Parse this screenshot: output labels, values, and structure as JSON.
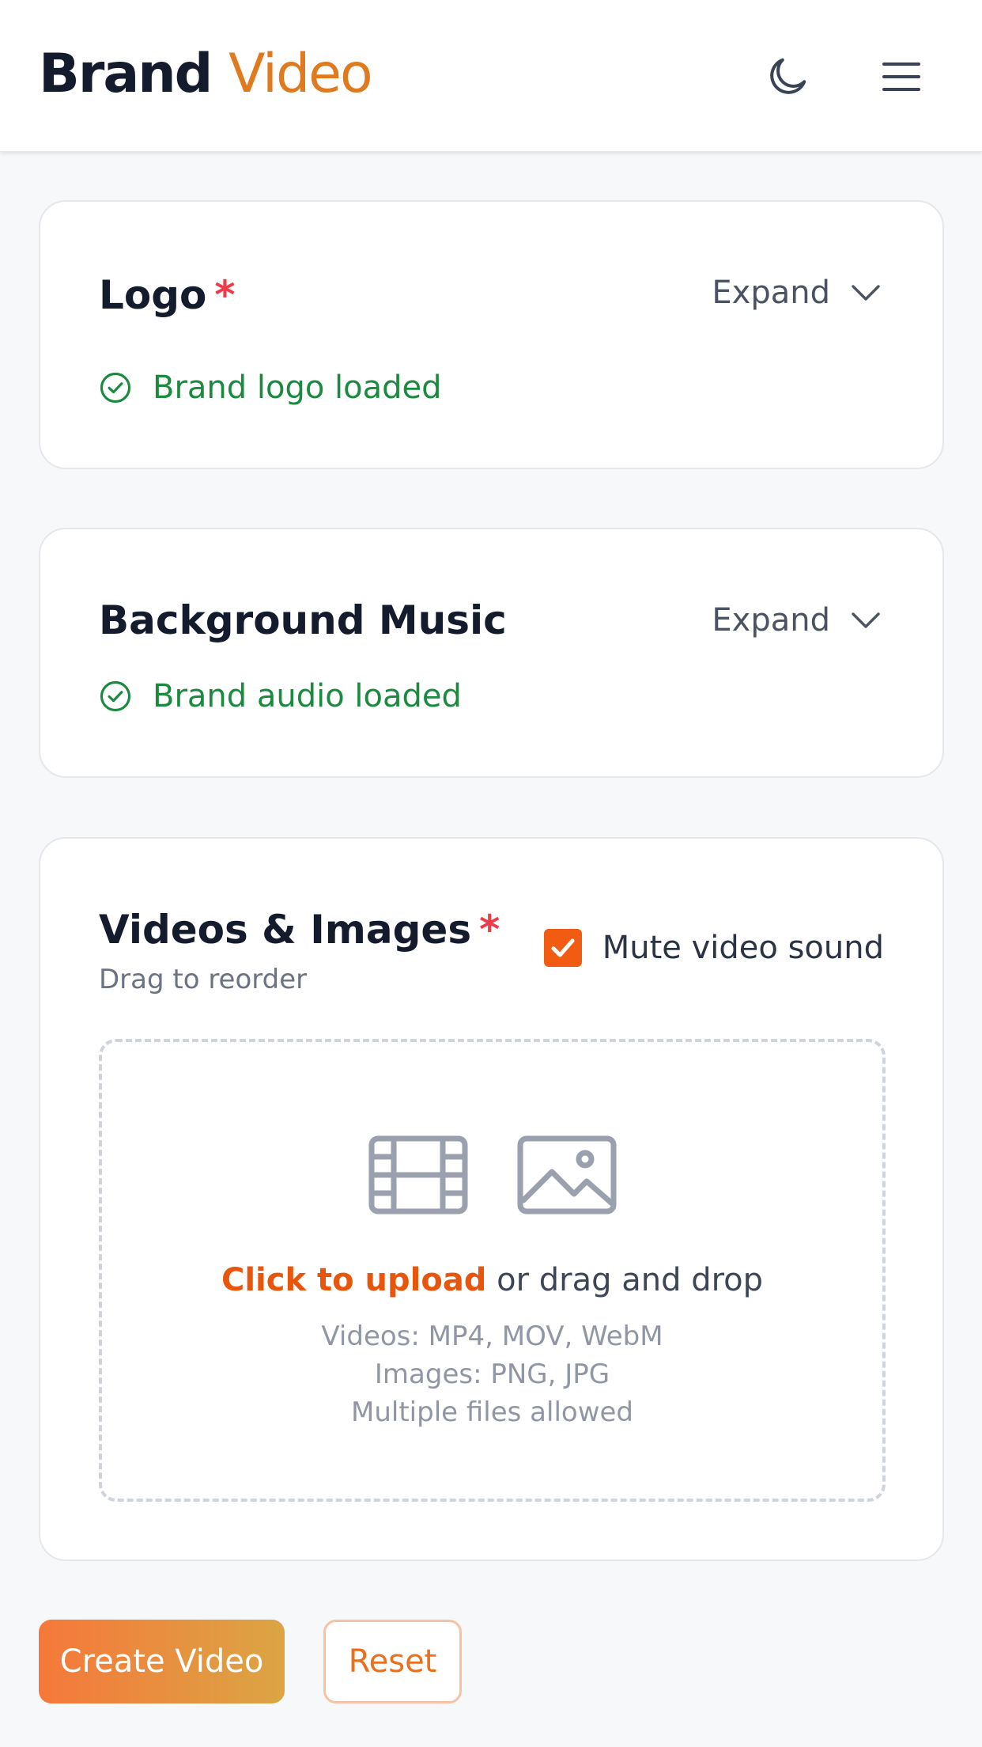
{
  "header": {
    "brand_main": "Brand",
    "brand_accent": "Video",
    "icons": {
      "theme": "moon-icon",
      "menu": "hamburger-menu-icon"
    }
  },
  "logo_section": {
    "title": "Logo",
    "required_mark": "*",
    "expand_label": "Expand",
    "status": "Brand logo loaded"
  },
  "music_section": {
    "title": "Background Music",
    "expand_label": "Expand",
    "status": "Brand audio loaded"
  },
  "media_section": {
    "title": "Videos & Images",
    "required_mark": "*",
    "subtitle": "Drag to reorder",
    "mute_label": "Mute video sound",
    "mute_checked": true,
    "dropzone": {
      "link_text": "Click to upload",
      "rest_text": " or drag and drop",
      "videos_formats": "Videos: MP4, MOV, WebM",
      "images_formats": "Images: PNG, JPG",
      "multiple_note": "Multiple files allowed"
    }
  },
  "actions": {
    "create_label": "Create Video",
    "reset_label": "Reset"
  },
  "colors": {
    "accent": "#e07a1f",
    "link_orange": "#e8560e",
    "success_green": "#1b8a3f",
    "required_red": "#ef3b47",
    "checkbox_orange": "#f25c12"
  }
}
